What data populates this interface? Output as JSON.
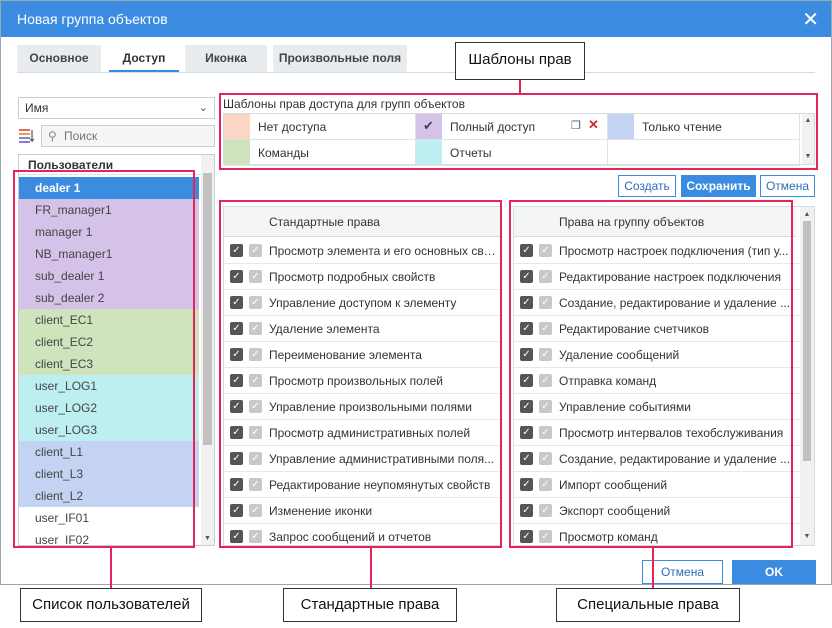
{
  "dialog": {
    "title": "Новая группа объектов",
    "close_label": "✕"
  },
  "tabs": [
    {
      "label": "Основное",
      "active": false
    },
    {
      "label": "Доступ",
      "active": true
    },
    {
      "label": "Иконка",
      "active": false
    },
    {
      "label": "Произвольные поля",
      "active": false
    }
  ],
  "users": {
    "sort_select": "Имя",
    "search_placeholder": "Поиск",
    "header": "Пользователи",
    "items": [
      {
        "name": "dealer 1",
        "color": "#3b8ce0",
        "selected": true
      },
      {
        "name": "FR_manager1",
        "color": "#d5c2e8"
      },
      {
        "name": "manager 1",
        "color": "#d5c2e8"
      },
      {
        "name": "NB_manager1",
        "color": "#d5c2e8"
      },
      {
        "name": "sub_dealer 1",
        "color": "#d5c2e8"
      },
      {
        "name": "sub_dealer 2",
        "color": "#d5c2e8"
      },
      {
        "name": "client_EC1",
        "color": "#cfe3bd"
      },
      {
        "name": "client_EC2",
        "color": "#cfe3bd"
      },
      {
        "name": "client_EC3",
        "color": "#cfe3bd"
      },
      {
        "name": "user_LOG1",
        "color": "#bdeef0"
      },
      {
        "name": "user_LOG2",
        "color": "#bdeef0"
      },
      {
        "name": "user_LOG3",
        "color": "#bdeef0"
      },
      {
        "name": "client_L1",
        "color": "#c3d3f1"
      },
      {
        "name": "client_L3",
        "color": "#c3d3f1"
      },
      {
        "name": "client_L2",
        "color": "#c3d3f1"
      },
      {
        "name": "user_IF01",
        "color": "#ffffff"
      },
      {
        "name": "user_IF02",
        "color": "#ffffff"
      }
    ]
  },
  "templates": {
    "label": "Шаблоны прав доступа для групп объектов",
    "items": [
      {
        "label": "Нет доступа",
        "color": "#fbd6c4"
      },
      {
        "label": "Полный доступ",
        "color": "#d5c2e8",
        "checked": true
      },
      {
        "label": "Только чтение",
        "color": "#c3d3f1"
      },
      {
        "label": "Команды",
        "color": "#cfe3bd"
      },
      {
        "label": "Отчеты",
        "color": "#bdeef0"
      }
    ],
    "actions": {
      "create": "Создать",
      "save": "Сохранить",
      "cancel": "Отмена"
    }
  },
  "standard_rights": {
    "header": "Стандартные права",
    "items": [
      "Просмотр элемента и его основных сво...",
      "Просмотр подробных свойств",
      "Управление доступом к элементу",
      "Удаление элемента",
      "Переименование элемента",
      "Просмотр произвольных полей",
      "Управление произвольными полями",
      "Просмотр административных полей",
      "Управление административными поля...",
      "Редактирование неупомянутых свойств",
      "Изменение иконки",
      "Запрос сообщений и отчетов"
    ]
  },
  "group_rights": {
    "header": "Права на группу объектов",
    "items": [
      "Просмотр настроек подключения (тип у...",
      "Редактирование настроек подключения",
      "Создание, редактирование и удаление ...",
      "Редактирование счетчиков",
      "Удаление сообщений",
      "Отправка команд",
      "Управление событиями",
      "Просмотр интервалов техобслуживания",
      "Создание, редактирование и удаление ...",
      "Импорт сообщений",
      "Экспорт сообщений",
      "Просмотр команд"
    ]
  },
  "footer": {
    "cancel": "Отмена",
    "ok": "OK"
  },
  "annotations": {
    "templates": "Шаблоны прав",
    "users": "Список пользователей",
    "standard": "Стандартные права",
    "special": "Специальные права",
    "accent_color": "#e5245a"
  }
}
